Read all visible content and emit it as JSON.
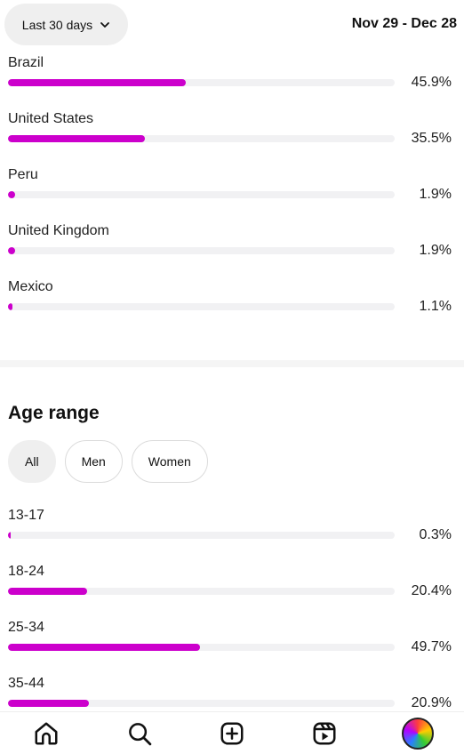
{
  "header": {
    "range_label": "Last 30 days",
    "date_range": "Nov 29 - Dec 28"
  },
  "locations": [
    {
      "label": "Brazil",
      "percent": 45.9,
      "pct_text": "45.9%"
    },
    {
      "label": "United States",
      "percent": 35.5,
      "pct_text": "35.5%"
    },
    {
      "label": "Peru",
      "percent": 1.9,
      "pct_text": "1.9%"
    },
    {
      "label": "United Kingdom",
      "percent": 1.9,
      "pct_text": "1.9%"
    },
    {
      "label": "Mexico",
      "percent": 1.1,
      "pct_text": "1.1%"
    }
  ],
  "age_range": {
    "title": "Age range",
    "filters": [
      {
        "label": "All",
        "active": true
      },
      {
        "label": "Men",
        "active": false
      },
      {
        "label": "Women",
        "active": false
      }
    ],
    "rows": [
      {
        "label": "13-17",
        "percent": 0.3,
        "pct_text": "0.3%"
      },
      {
        "label": "18-24",
        "percent": 20.4,
        "pct_text": "20.4%"
      },
      {
        "label": "25-34",
        "percent": 49.7,
        "pct_text": "49.7%"
      },
      {
        "label": "35-44",
        "percent": 20.9,
        "pct_text": "20.9%"
      }
    ]
  },
  "bottom_nav": {
    "items": [
      "home-icon",
      "search-icon",
      "create-icon",
      "reels-icon",
      "profile-avatar"
    ]
  },
  "colors": {
    "bar_fill": "#cc00cc",
    "bar_track": "#f1f1f3"
  }
}
